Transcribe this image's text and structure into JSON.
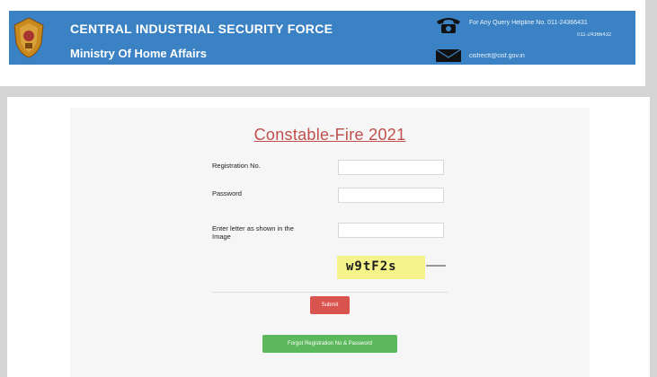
{
  "header": {
    "org_name": "CENTRAL INDUSTRIAL SECURITY FORCE",
    "ministry": "Ministry Of Home Affairs",
    "helpline": "For Any Query Helpline No. 011-24366431",
    "phone_no": "011-24366432",
    "email": "cisfrectt@cisf.gov.in"
  },
  "form": {
    "title": "Constable-Fire 2021",
    "registration_label": "Registration No.",
    "password_label": "Password",
    "captcha_label_line1": "Enter letter as shown in the",
    "captcha_label_line2": "Image",
    "captcha_text": "w9tF2s",
    "submit_label": "Submit",
    "forgot_label": "Forgot Registration No & Password"
  },
  "colors": {
    "header_bg": "#3b82c4",
    "title_color": "#c0504d",
    "submit_bg": "#d9534f",
    "forgot_bg": "#5cb85c",
    "captcha_bg": "#f5f48a"
  },
  "icons": {
    "emblem": "cisf-emblem-icon",
    "phone": "phone-icon",
    "mail": "mail-icon"
  }
}
